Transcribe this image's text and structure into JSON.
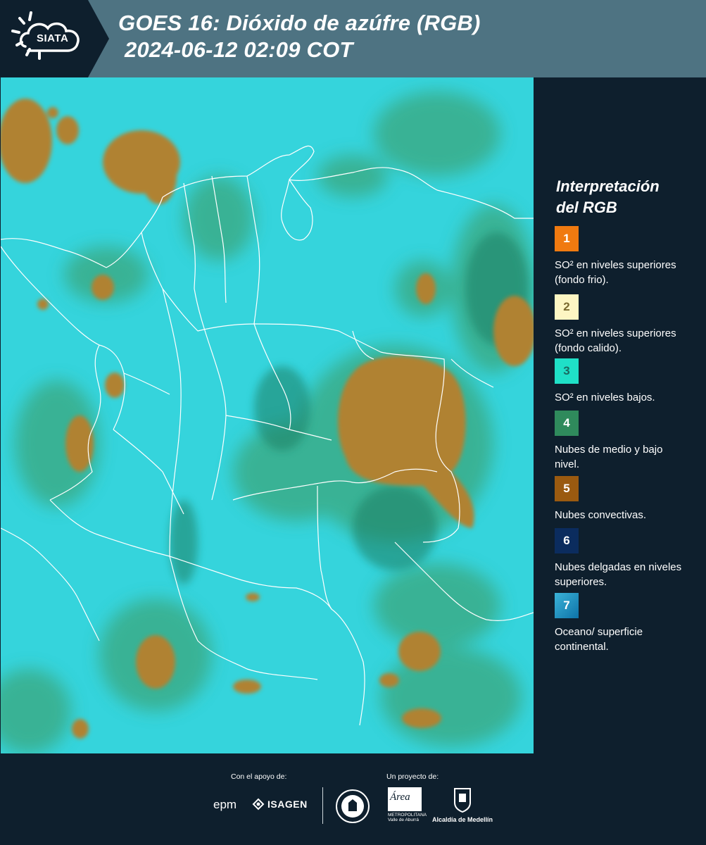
{
  "header": {
    "logo_text": "SIATA",
    "title_line1": "GOES 16: Dióxido de azúfre (RGB)",
    "title_line2": "2024-06-12 02:09 COT"
  },
  "legend": {
    "title_line1": "Interpretación",
    "title_line2": "del RGB",
    "items": [
      {
        "number": "1",
        "color": "#f07a10",
        "text": "SO² en niveles superiores (fondo frio)."
      },
      {
        "number": "2",
        "color": "#fdf6c3",
        "text": "SO² en niveles superiores (fondo calido)."
      },
      {
        "number": "3",
        "color": "#1fe0c7",
        "text": "SO² en niveles bajos."
      },
      {
        "number": "4",
        "color": "#2f8a5c",
        "text": "Nubes de medio y bajo nivel."
      },
      {
        "number": "5",
        "color": "#9a5a10",
        "text": "Nubes convectivas."
      },
      {
        "number": "6",
        "color": "#0b2c5e",
        "text": "Nubes delgadas en niveles superiores."
      },
      {
        "number": "7",
        "color": "#1f8fc4",
        "text": "Oceano/ superficie continental."
      }
    ]
  },
  "footer": {
    "support_label": "Con el apoyo de:",
    "project_label": "Un proyecto de:",
    "epm": "epm",
    "isagen": "ISAGEN",
    "area_metropolitana": "Área",
    "area_sub1": "METROPOLITANA",
    "area_sub2": "Valle de Aburrá",
    "alcaldia": "Alcaldía de Medellín"
  },
  "map": {
    "ocean_color": "#2fd5df",
    "convective_color": "#b0802a",
    "cloud_green": "#2e9a7a",
    "boundary_color": "#ffffff"
  }
}
